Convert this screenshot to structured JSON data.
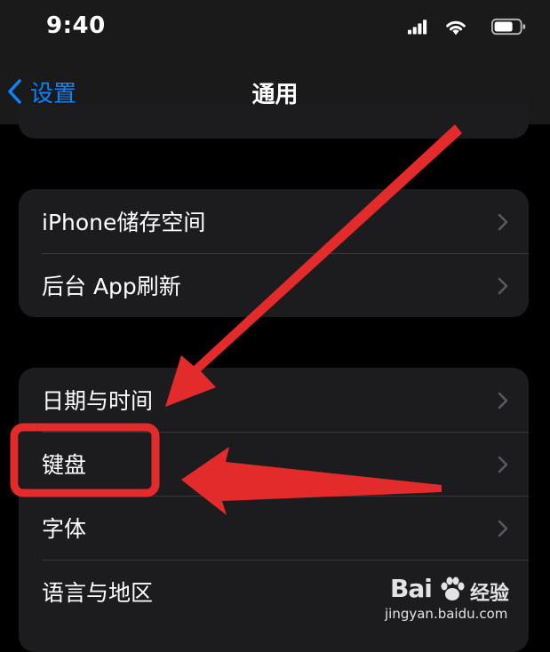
{
  "status_bar": {
    "time": "9:40"
  },
  "nav": {
    "back_label": "设置",
    "title": "通用"
  },
  "group1": {
    "items": [
      {
        "label": "iPhone储存空间"
      },
      {
        "label": "后台 App刷新"
      }
    ]
  },
  "group2": {
    "items": [
      {
        "label": "日期与时间"
      },
      {
        "label": "键盘"
      },
      {
        "label": "字体"
      },
      {
        "label": "语言与地区"
      }
    ]
  },
  "watermark": {
    "brand": "Bai",
    "brand_cn": "经验",
    "url": "jingyan.baidu.com"
  },
  "colors": {
    "accent": "#0a84ff",
    "annotation_red": "#e32b2b",
    "cell_bg": "#1c1c1e",
    "page_bg": "#000000"
  },
  "icons": [
    "chevron-left-icon",
    "chevron-right-icon",
    "signal-icon",
    "wifi-icon",
    "battery-icon",
    "paw-icon"
  ]
}
